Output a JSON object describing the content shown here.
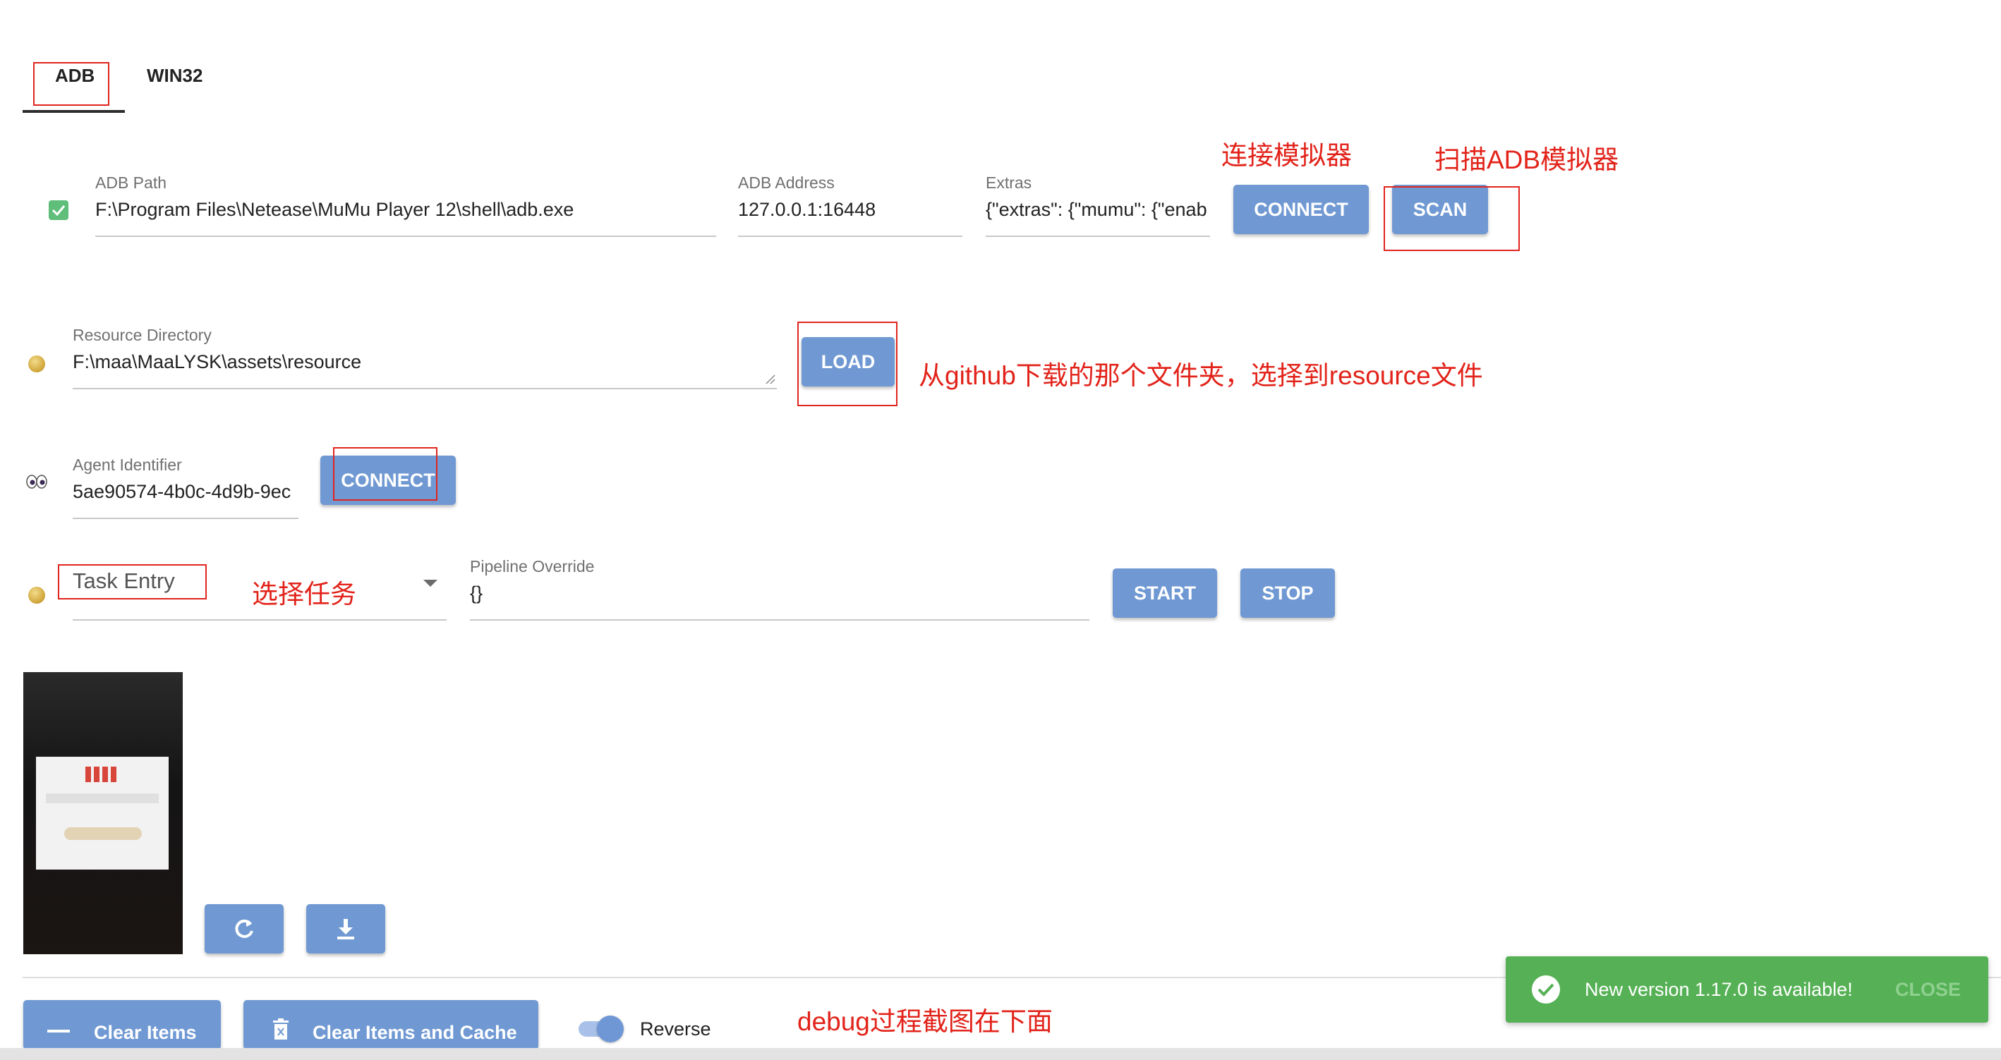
{
  "tabs": [
    {
      "label": "ADB"
    },
    {
      "label": "WIN32"
    }
  ],
  "adb": {
    "path_label": "ADB Path",
    "path_value": "F:\\Program Files\\Netease\\MuMu Player 12\\shell\\adb.exe",
    "address_label": "ADB Address",
    "address_value": "127.0.0.1:16448",
    "extras_label": "Extras",
    "extras_value": "{\"extras\": {\"mumu\": {\"enab",
    "connect_label": "CONNECT",
    "scan_label": "SCAN"
  },
  "resource": {
    "label": "Resource Directory",
    "value": "F:\\maa\\MaaLYSK\\assets\\resource",
    "load_label": "LOAD"
  },
  "agent": {
    "label": "Agent Identifier",
    "value": "5ae90574-4b0c-4d9b-9ec",
    "connect_label": "CONNECT"
  },
  "task": {
    "placeholder": "Task Entry",
    "pipeline_label": "Pipeline Override",
    "pipeline_value": "{}",
    "start_label": "START",
    "stop_label": "STOP"
  },
  "annotations": {
    "connect_emulator": "连接模拟器",
    "scan_emulator": "扫描ADB模拟器",
    "resource_hint": "从github下载的那个文件夹，选择到resource文件",
    "select_task": "选择任务",
    "debug_hint": "debug过程截图在下面"
  },
  "bottom": {
    "clear_items_label": "Clear Items",
    "clear_items_cache_label": "Clear Items and Cache",
    "reverse_label": "Reverse",
    "reverse_on": true
  },
  "toast": {
    "message": "New version 1.17.0 is available!",
    "close_label": "CLOSE"
  },
  "colors": {
    "button": "#7099d3",
    "annotation": "#e2231a",
    "toast": "#56b156"
  }
}
